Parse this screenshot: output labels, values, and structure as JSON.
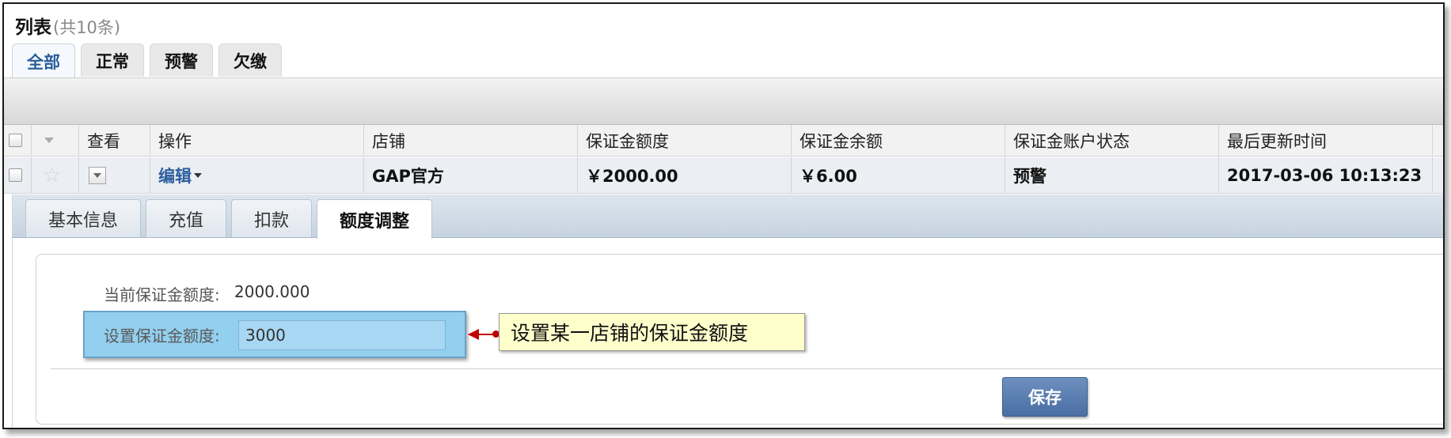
{
  "header": {
    "title": "列表",
    "count": "(共10条)"
  },
  "top_tabs": [
    {
      "label": "全部",
      "active": true
    },
    {
      "label": "正常",
      "active": false
    },
    {
      "label": "预警",
      "active": false
    },
    {
      "label": "欠缴",
      "active": false
    }
  ],
  "table": {
    "columns": [
      "查看",
      "操作",
      "店铺",
      "保证金额度",
      "保证金余额",
      "保证金账户状态",
      "最后更新时间"
    ],
    "row": {
      "action": "编辑",
      "store": "GAP官方",
      "deposit_limit": "￥2000.00",
      "deposit_balance": "￥6.00",
      "status": "预警",
      "updated_at": "2017-03-06 10:13:23"
    }
  },
  "detail": {
    "tabs": [
      {
        "label": "基本信息",
        "active": false
      },
      {
        "label": "充值",
        "active": false
      },
      {
        "label": "扣款",
        "active": false
      },
      {
        "label": "额度调整",
        "active": true
      }
    ],
    "current_label": "当前保证金额度:",
    "current_value": "2000.000",
    "set_label": "设置保证金额度:",
    "set_value": "3000",
    "callout": "设置某一店铺的保证金额度",
    "save_label": "保存"
  },
  "colors": {
    "accent": "#2b5e9c",
    "highlight": "#93cfee",
    "callout_bg": "#ffffcc",
    "arrow": "#c00000",
    "button": "#4a6ea3"
  }
}
